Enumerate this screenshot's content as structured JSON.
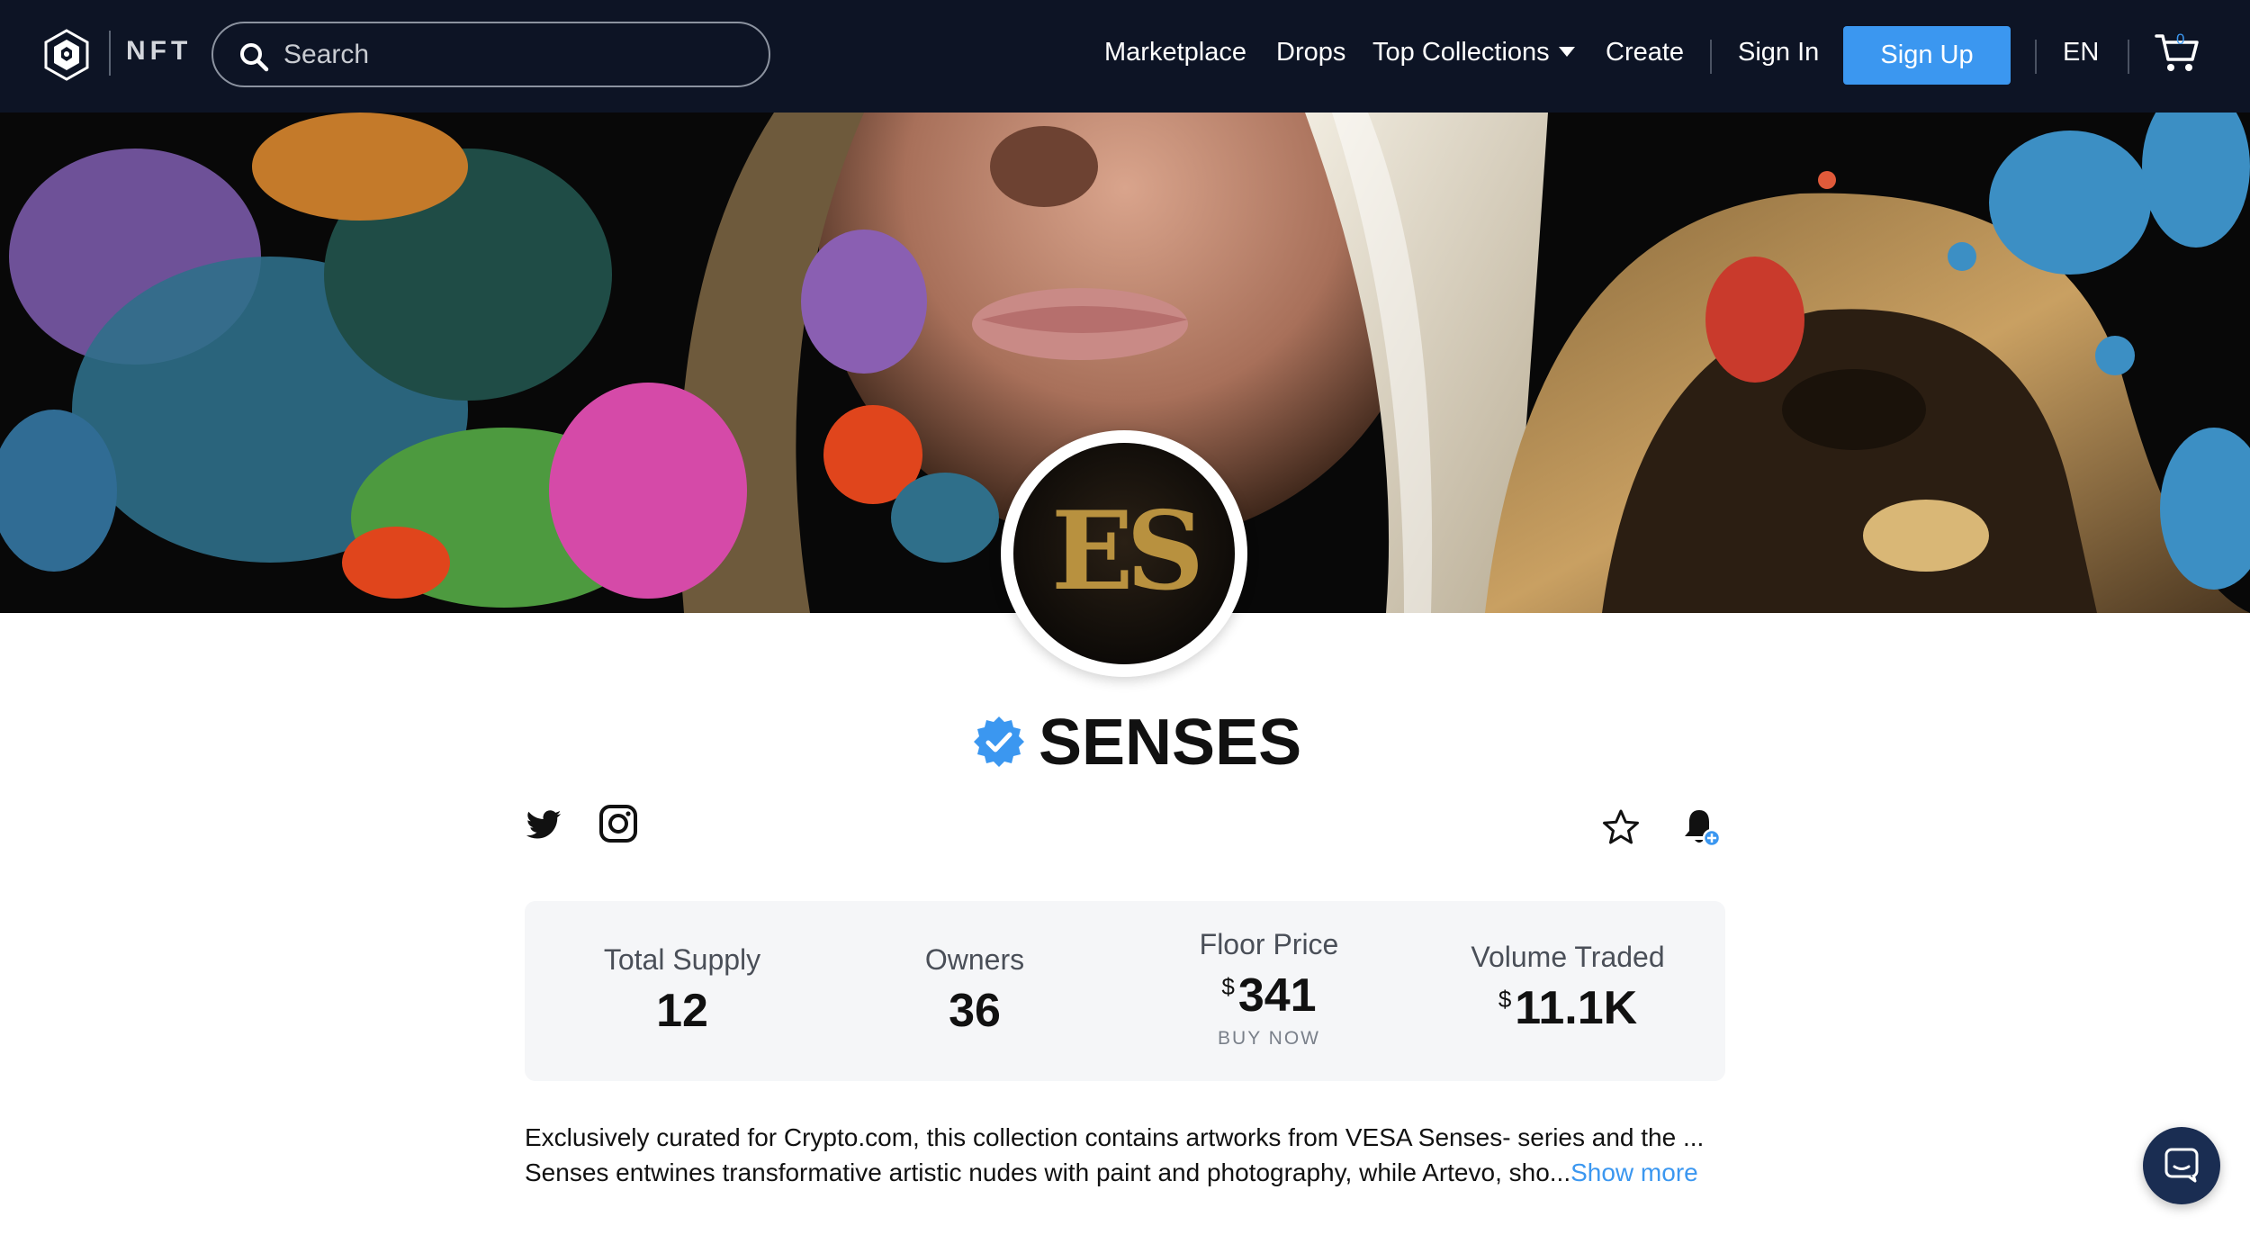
{
  "nav": {
    "logo_icon": "crypto-com-lion-shield",
    "brand": "NFT",
    "search_placeholder": "Search",
    "links": [
      "Marketplace",
      "Drops",
      "Top Collections",
      "Create"
    ],
    "sign_in": "Sign In",
    "sign_up": "Sign Up",
    "language": "EN",
    "cart_count": "0",
    "accent_color": "#3b97f0",
    "bar_color": "#0d1425"
  },
  "collection": {
    "name": "SENSES",
    "verified": true,
    "avatar_text": "ES",
    "social": [
      "twitter-icon",
      "instagram-icon"
    ],
    "actions": [
      "star-icon",
      "bell-plus-icon"
    ]
  },
  "stats": {
    "total_supply_label": "Total Supply",
    "total_supply_value": "12",
    "owners_label": "Owners",
    "owners_value": "36",
    "floor_price_label": "Floor Price",
    "floor_price_currency": "$",
    "floor_price_value": "341",
    "floor_price_cta": "BUY NOW",
    "volume_label": "Volume Traded",
    "volume_currency": "$",
    "volume_value": "11.1K"
  },
  "description": {
    "line1": "Exclusively curated for Crypto.com, this collection contains artworks from VESA Senses- series and the ...",
    "line2": "Senses entwines transformative artistic nudes with paint and photography, while Artevo, sho...",
    "show_more": "Show more"
  },
  "chat": {
    "icon": "chat-bubble-icon"
  }
}
